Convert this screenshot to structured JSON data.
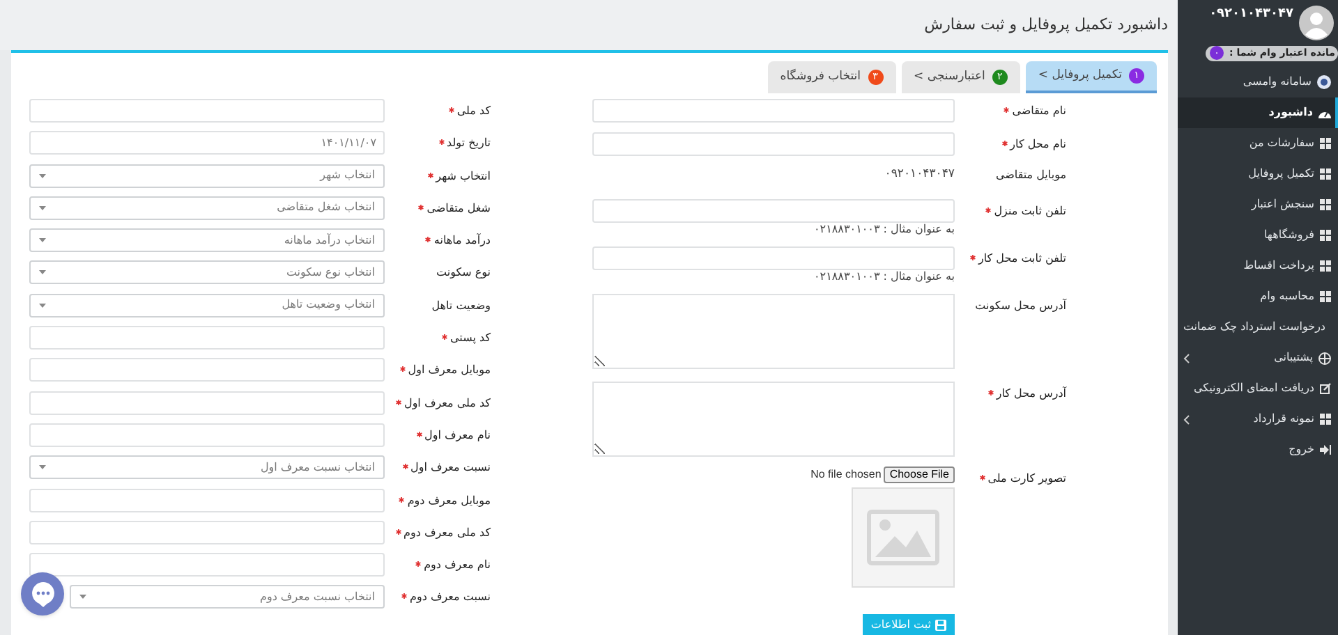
{
  "header": {
    "title": "داشبورد تکمیل پروفایل و ثبت سفارش"
  },
  "sidebar": {
    "user_phone": "۰۹۲۰۱۰۴۳۰۴۷",
    "credit_label": "مانده اعتبار وام شما :",
    "credit_value": "۰",
    "items": [
      {
        "kind": "brand",
        "label": "سامانه وامسی",
        "selected": false
      },
      {
        "kind": "dashboard",
        "label": "داشبورد",
        "selected": true
      },
      {
        "kind": "page",
        "label": "سفارشات من",
        "selected": false
      },
      {
        "kind": "page",
        "label": "تکمیل پروفایل",
        "selected": false
      },
      {
        "kind": "page",
        "label": "سنجش اعتبار",
        "selected": false
      },
      {
        "kind": "page",
        "label": "فروشگاهها",
        "selected": false
      },
      {
        "kind": "page",
        "label": "پرداخت اقساط",
        "selected": false
      },
      {
        "kind": "page",
        "label": "محاسبه وام",
        "selected": false
      },
      {
        "kind": "page",
        "label": "درخواست استرداد چک ضمانت",
        "selected": false
      },
      {
        "kind": "support",
        "label": "پشتیبانی",
        "selected": false,
        "expanded": false
      },
      {
        "kind": "signature",
        "label": "دریافت امضای الکترونیکی",
        "selected": false
      },
      {
        "kind": "submenu",
        "label": "نمونه قرارداد",
        "selected": false,
        "expanded": false
      },
      {
        "kind": "logout",
        "label": "خروج",
        "selected": false
      }
    ]
  },
  "tabs": [
    {
      "number": "۱",
      "label": "تکمیل پروفایل >",
      "color": "#8a2be2",
      "selected": true
    },
    {
      "number": "۲",
      "label": "اعتبارسنجی >",
      "color": "#1e8a1e",
      "selected": false
    },
    {
      "number": "۳",
      "label": "انتخاب فروشگاه",
      "color": "#f04a1a",
      "selected": false
    }
  ],
  "form_right": [
    {
      "kind": "text",
      "label": "نام متقاضی",
      "required": true
    },
    {
      "kind": "text",
      "label": "نام محل کار",
      "required": true
    },
    {
      "kind": "static",
      "label": "موبایل متقاضی",
      "required": false,
      "value": "۰۹۲۰۱۰۴۳۰۴۷"
    },
    {
      "kind": "text",
      "label": "تلفن ثابت منزل",
      "required": true,
      "hint": "به عنوان مثال : ۰۲۱۸۸۳۰۱۰۰۳"
    },
    {
      "kind": "text",
      "label": "تلفن ثابت محل کار",
      "required": true,
      "hint": "به عنوان مثال : ۰۲۱۸۸۳۰۱۰۰۳"
    },
    {
      "kind": "textarea",
      "label": "آدرس محل سکونت",
      "required": false
    },
    {
      "kind": "textarea",
      "label": "آدرس محل کار",
      "required": true
    },
    {
      "kind": "file",
      "label": "تصویر کارت ملی",
      "required": true,
      "button": "Choose File",
      "status": "No file chosen"
    }
  ],
  "form_left": [
    {
      "kind": "text",
      "label": "کد ملی",
      "required": true
    },
    {
      "kind": "text",
      "label": "تاریخ تولد",
      "required": true,
      "value": "۱۴۰۱/۱۱/۰۷"
    },
    {
      "kind": "select",
      "label": "انتخاب شهر",
      "required": true,
      "placeholder": "انتخاب شهر"
    },
    {
      "kind": "select",
      "label": "شغل متقاضی",
      "required": true,
      "placeholder": "انتخاب شغل متقاضی"
    },
    {
      "kind": "select",
      "label": "درآمد ماهانه",
      "required": true,
      "placeholder": "انتخاب درآمد ماهانه"
    },
    {
      "kind": "select",
      "label": "نوع سکونت",
      "required": false,
      "placeholder": "انتخاب نوع سکونت"
    },
    {
      "kind": "select",
      "label": "وضعیت تاهل",
      "required": false,
      "placeholder": "انتخاب وضعیت تاهل"
    },
    {
      "kind": "text",
      "label": "کد پستی",
      "required": true
    },
    {
      "kind": "text",
      "label": "موبایل معرف اول",
      "required": true
    },
    {
      "kind": "text",
      "label": "کد ملی معرف اول",
      "required": true
    },
    {
      "kind": "text",
      "label": "نام معرف اول",
      "required": true
    },
    {
      "kind": "select",
      "label": "نسبت معرف اول",
      "required": true,
      "placeholder": "انتخاب نسبت معرف اول"
    },
    {
      "kind": "text",
      "label": "موبایل معرف دوم",
      "required": true
    },
    {
      "kind": "text",
      "label": "کد ملی معرف دوم",
      "required": true
    },
    {
      "kind": "text",
      "label": "نام معرف دوم",
      "required": true
    },
    {
      "kind": "select",
      "label": "نسبت معرف دوم",
      "required": true,
      "placeholder": "انتخاب نسبت معرف دوم"
    }
  ],
  "submit_button": "ثبت اطلاعات"
}
